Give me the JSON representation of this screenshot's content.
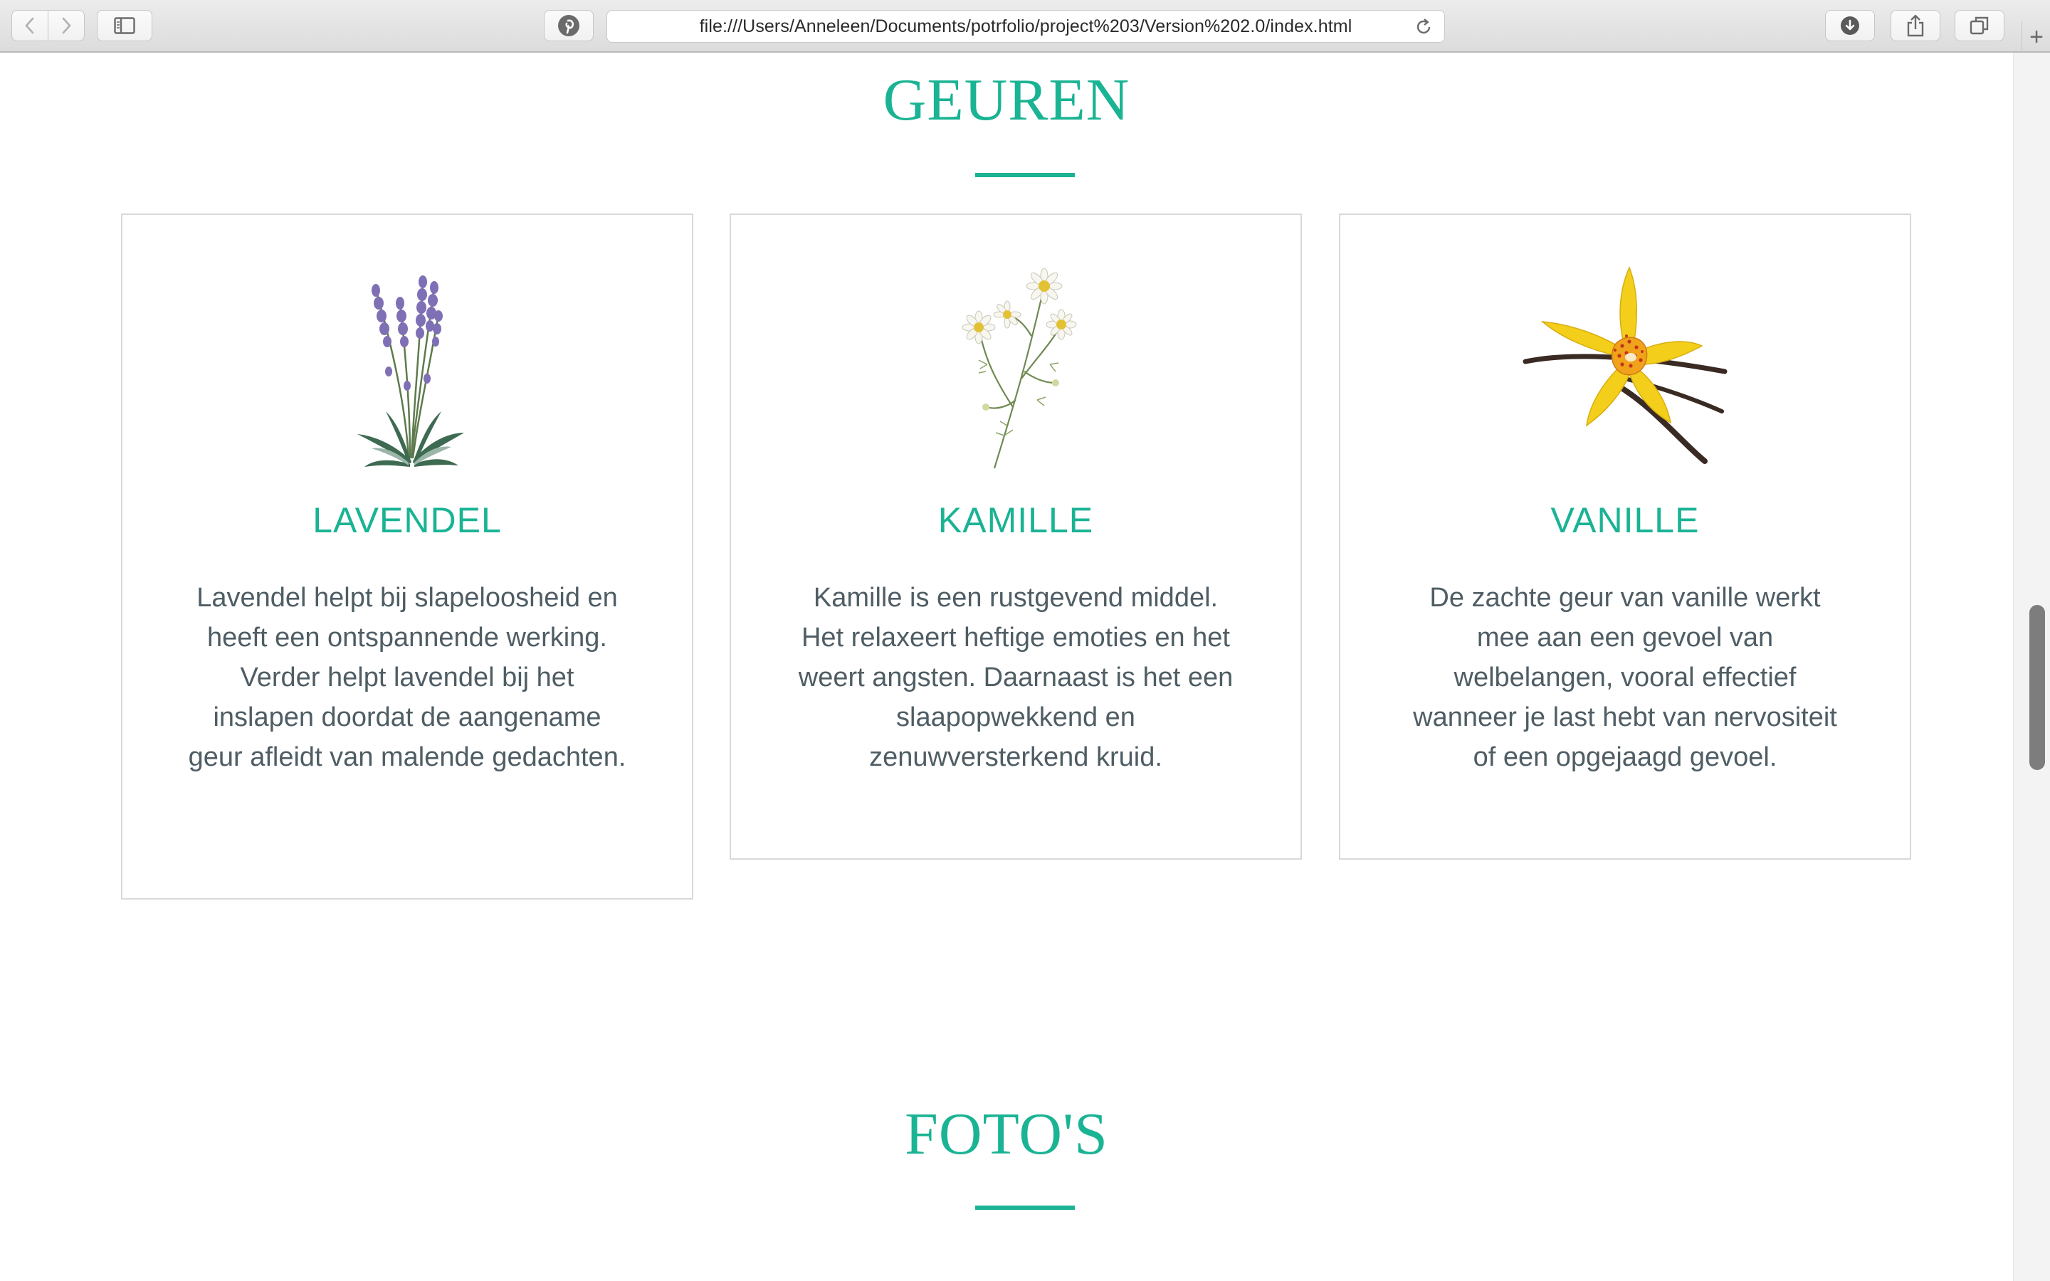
{
  "browser": {
    "url": "file:///Users/Anneleen/Documents/potrfolio/project%203/Version%202.0/index.html",
    "icons": [
      "back-icon",
      "forward-icon",
      "sidebar-icon",
      "pinterest-icon",
      "reload-icon",
      "download-icon",
      "share-icon",
      "tabs-icon",
      "plus-icon"
    ],
    "new_tab_label": "+"
  },
  "page": {
    "section1_title": "GEUREN",
    "section2_title": "FOTO'S",
    "accent_color": "#1ab394",
    "cards": [
      {
        "title": "LAVENDEL",
        "description": "Lavendel helpt bij slapeloosheid en heeft een ontspannende werking. Verder helpt lavendel bij het inslapen doordat de aangename geur afleidt van malende gedachten.",
        "image": "lavender-illustration"
      },
      {
        "title": "KAMILLE",
        "description": "Kamille is een rustgevend middel. Het relaxeert heftige emoties en het weert angsten. Daarnaast is het een slaapopwekkend en zenuwversterkend kruid.",
        "image": "chamomile-illustration"
      },
      {
        "title": "VANILLE",
        "description": "De zachte geur van vanille werkt mee aan een gevoel van welbelangen, vooral effectief wanneer je last hebt van nervositeit of een opgejaagd gevoel.",
        "image": "vanilla-orchid-photo"
      }
    ]
  }
}
